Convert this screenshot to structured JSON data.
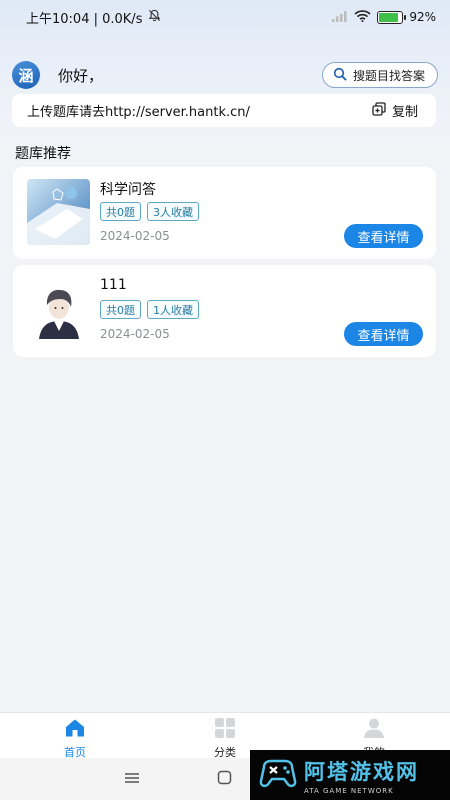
{
  "status_bar": {
    "time_speed": "上午10:04 | 0.0K/s",
    "battery": "92%"
  },
  "header": {
    "logo_char": "涵",
    "greeting": "你好，",
    "search_label": "搜题目找答案"
  },
  "upload_bar": {
    "text": "上传题库请去http://server.hantk.cn/",
    "copy_label": "复制"
  },
  "section_title": "题库推荐",
  "cards": [
    {
      "title": "科学问答",
      "tag_count": "共0题",
      "tag_fav": "3人收藏",
      "date": "2024-02-05",
      "button": "查看详情"
    },
    {
      "title": "111",
      "tag_count": "共0题",
      "tag_fav": "1人收藏",
      "date": "2024-02-05",
      "button": "查看详情"
    }
  ],
  "tabbar": {
    "tabs": [
      {
        "label": "首页",
        "icon": "home-icon",
        "active": true
      },
      {
        "label": "分类",
        "icon": "grid-icon",
        "active": false
      },
      {
        "label": "我的",
        "icon": "user-icon",
        "active": false
      }
    ]
  },
  "watermark": {
    "cn": "阿塔游戏网",
    "en": "ATA GAME NETWORK"
  },
  "colors": {
    "accent": "#1c86e6",
    "tag_border": "#5fa8c8"
  }
}
